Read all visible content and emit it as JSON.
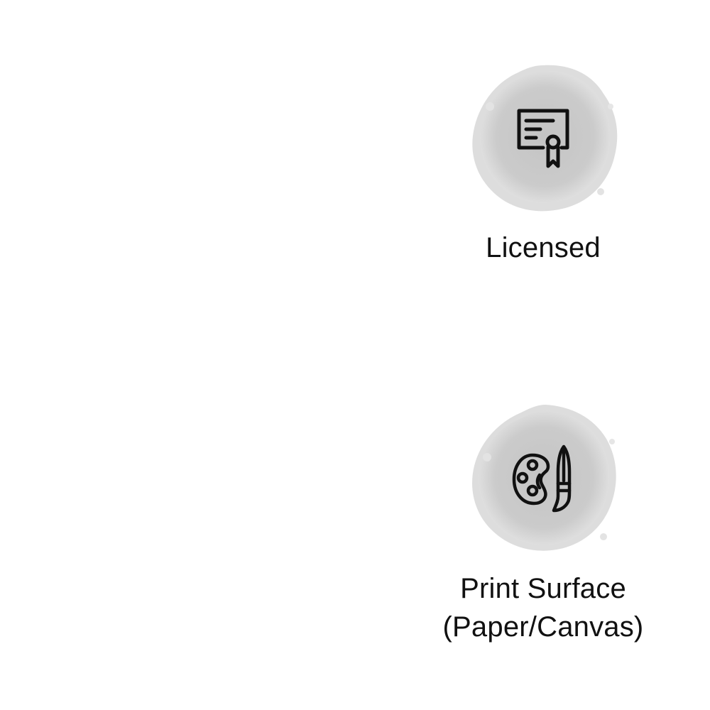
{
  "colors": {
    "blob": "#c9c9c9",
    "blob_edge": "#dcdcdc",
    "icon": "#111111",
    "text": "#111111",
    "background": "#ffffff"
  },
  "features": [
    {
      "icon": "certificate-icon",
      "label": "Licensed"
    },
    {
      "icon": "palette-brush-icon",
      "label_line1": "Print Surface",
      "label_line2": "(Paper/Canvas)"
    }
  ]
}
